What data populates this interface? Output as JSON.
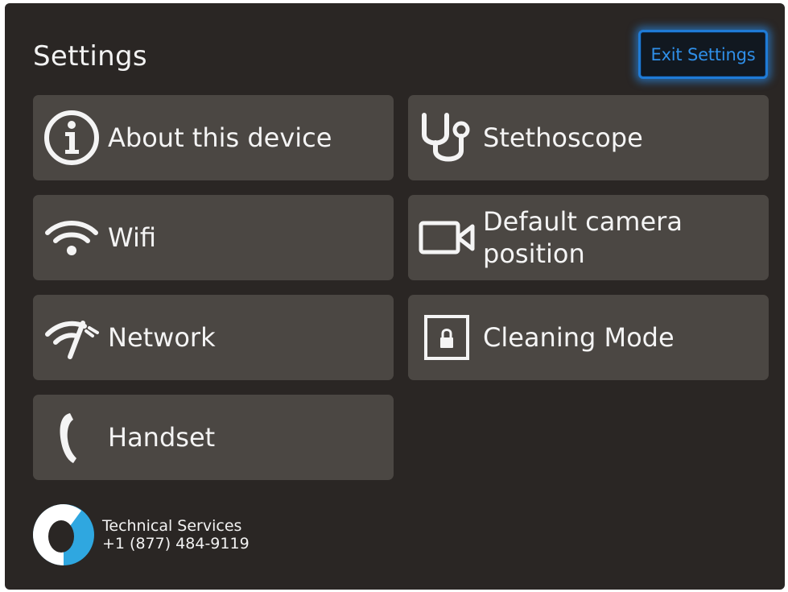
{
  "header": {
    "title": "Settings",
    "exit_label": "Exit Settings"
  },
  "tiles": [
    {
      "label": "About this device",
      "icon": "info-icon"
    },
    {
      "label": "Stethoscope",
      "icon": "stethoscope-icon"
    },
    {
      "label": "Wifi",
      "icon": "wifi-icon"
    },
    {
      "label": "Default camera position",
      "icon": "video-camera-icon"
    },
    {
      "label": "Network",
      "icon": "network-icon"
    },
    {
      "label": "Cleaning Mode",
      "icon": "lock-screen-icon"
    },
    {
      "label": "Handset",
      "icon": "phone-handset-icon"
    }
  ],
  "footer": {
    "line1": "Technical Services",
    "line2": "+1 (877) 484-9119"
  },
  "colors": {
    "background": "#2a2624",
    "tile": "#4b4743",
    "accent": "#1f7bd6",
    "logo_blue": "#2fa7e0"
  }
}
